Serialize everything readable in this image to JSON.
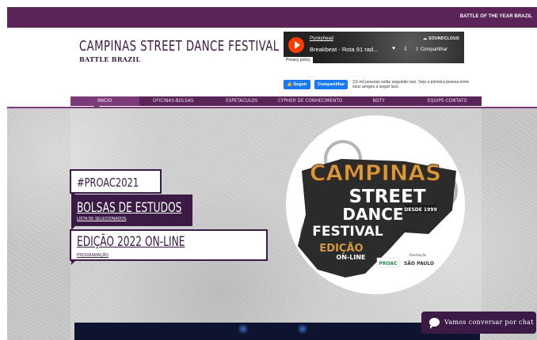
{
  "topbar": {
    "brand": "BATTLE OF THE YEAR BRAZIL"
  },
  "header": {
    "title": "CAMPINAS STREET DANCE FESTIVAL",
    "subtitle": "BATTLE BRAZIL"
  },
  "soundcloud": {
    "artist": "Punkyhead",
    "track": "Breakbeat - Rota 91 rad...",
    "brand": "SOUNDCLOUD",
    "share_label": "Compartilhar",
    "privacy": "Privacy policy"
  },
  "facebook": {
    "follow_label": "Seguir",
    "share_label": "Compartilhar",
    "followers_text": "3,5 mil pessoas estão seguindo isso. Seja a primeira pessoa entre seus amigos a seguir isso."
  },
  "nav": {
    "items": [
      {
        "label": "INICIO"
      },
      {
        "label": "OFICINAS-BOLSAS"
      },
      {
        "label": "ESPETACULOS"
      },
      {
        "label": "CYPHER DE CONHECIMENTO"
      },
      {
        "label": "BOTY"
      },
      {
        "label": "EQUIPE-CONTATO"
      }
    ],
    "active_index": 0
  },
  "hero": {
    "proac": "#PROAC2021",
    "bolsas_title": "BOLSAS DE ESTUDOS",
    "bolsas_link": "LISTA DE SELECIONADOS",
    "edicao_title": "EDIÇÃO 2022 ON-LINE",
    "edicao_link": "PROGRAMAÇÃO"
  },
  "logo": {
    "line1": "CAMPINAS",
    "line2": "STREET",
    "line3": "DANCE",
    "line4": "FESTIVAL",
    "since": "DESDE 1999",
    "edition1": "EDIÇÃO",
    "edition2": "ON-LINE",
    "sponsor_caption": "Realização",
    "proac": "PROAC",
    "saopaulo": "SÃO PAULO"
  },
  "chat": {
    "label": "Vamos conversar por chat"
  },
  "colors": {
    "primary": "#5b2458",
    "dark": "#3b1a45",
    "accent": "#7c3a78",
    "facebook": "#1877f2",
    "soundcloud": "#ff3b00"
  }
}
